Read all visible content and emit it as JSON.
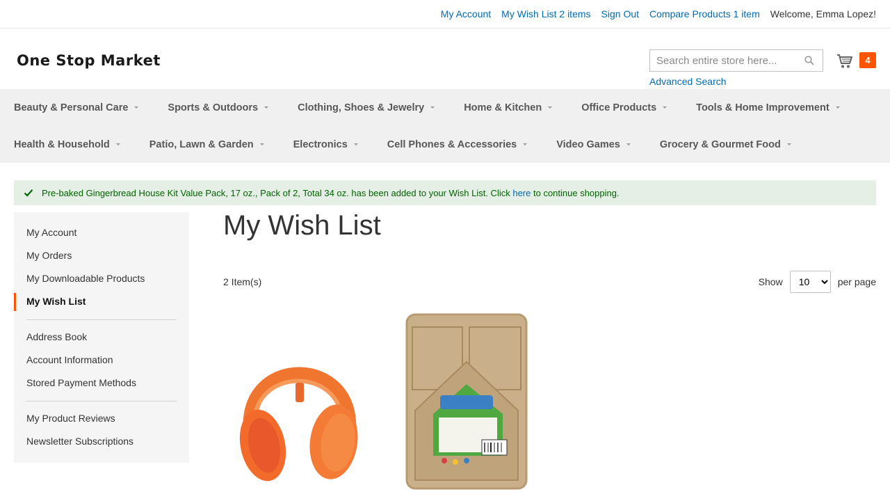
{
  "top_links": {
    "my_account": "My Account",
    "wish_list": "My Wish List 2 items",
    "sign_out": "Sign Out",
    "compare": "Compare Products 1 item",
    "welcome": "Welcome, Emma Lopez!"
  },
  "header": {
    "logo": "One Stop Market",
    "search_placeholder": "Search entire store here...",
    "advanced_search": "Advanced Search",
    "cart_count": "4"
  },
  "nav": {
    "row1": [
      "Beauty & Personal Care",
      "Sports & Outdoors",
      "Clothing, Shoes & Jewelry",
      "Home & Kitchen",
      "Office Products",
      "Tools & Home Improvement"
    ],
    "row2": [
      "Health & Household",
      "Patio, Lawn & Garden",
      "Electronics",
      "Cell Phones & Accessories",
      "Video Games",
      "Grocery & Gourmet Food"
    ]
  },
  "message": {
    "before": "Pre-baked Gingerbread House Kit Value Pack, 17 oz., Pack of 2, Total 34 oz. has been added to your Wish List. Click ",
    "link": "here",
    "after": " to continue shopping."
  },
  "sidebar": {
    "items": [
      "My Account",
      "My Orders",
      "My Downloadable Products",
      "My Wish List",
      "Address Book",
      "Account Information",
      "Stored Payment Methods",
      "My Product Reviews",
      "Newsletter Subscriptions"
    ]
  },
  "main": {
    "title": "My Wish List",
    "item_count": "2 Item(s)",
    "show_label": "Show",
    "per_page_value": "10",
    "per_page_label": "per page"
  },
  "products": [
    {
      "icon": "orange-headphones-image"
    },
    {
      "icon": "gingerbread-house-kit-image"
    }
  ],
  "colors": {
    "link": "#006bb4",
    "accent": "#ff5501",
    "success_bg": "#e5efe5",
    "success_text": "#006400"
  }
}
